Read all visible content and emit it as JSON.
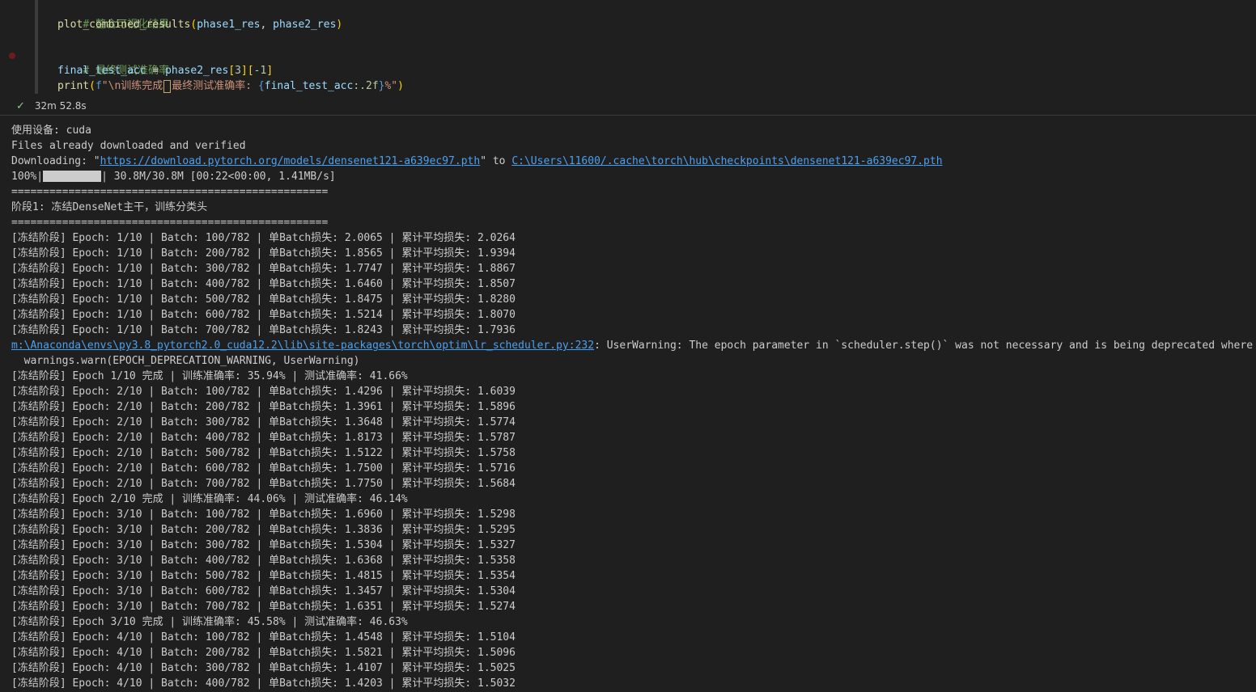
{
  "code_cell": {
    "lines": [
      {
        "comment": "# 整合可视化结果"
      },
      {
        "fn": "plot_combined_results",
        "arg1": "phase1_res",
        "arg2": "phase2_res"
      },
      {},
      {
        "comment": "# 最终测试准确率"
      },
      {
        "var": "final_test_acc",
        "rhs": "phase2_res",
        "idx1": "3",
        "idx2": "-1"
      },
      {
        "fn": "print",
        "fprefix": "f",
        "str_a": "\"\\n训练完成",
        "str_b": "最终测试准确率: ",
        "expr": "final_test_acc",
        "fmt": ":.2f",
        "str_c": "%\""
      }
    ]
  },
  "status": {
    "duration": "32m 52.8s",
    "icon": "check-icon"
  },
  "output": {
    "lines": [
      "使用设备: cuda",
      "Files already downloaded and verified",
      {
        "prefix": "Downloading: \"",
        "link1": "https://download.pytorch.org/models/densenet121-a639ec97.pth",
        "middle": "\" to ",
        "link2": "C:\\Users\\11600/.cache\\torch\\hub\\checkpoints\\densenet121-a639ec97.pth"
      },
      {
        "progress_prefix": "100%|",
        "progress_value": 1.0,
        "progress_suffix": "| 30.8M/30.8M [00:22<00:00, 1.41MB/s]"
      },
      "==================================================",
      "阶段1: 冻结DenseNet主干，训练分类头",
      "==================================================",
      "[冻结阶段] Epoch: 1/10 | Batch: 100/782 | 单Batch损失: 2.0065 | 累计平均损失: 2.0264",
      "[冻结阶段] Epoch: 1/10 | Batch: 200/782 | 单Batch损失: 1.8565 | 累计平均损失: 1.9394",
      "[冻结阶段] Epoch: 1/10 | Batch: 300/782 | 单Batch损失: 1.7747 | 累计平均损失: 1.8867",
      "[冻结阶段] Epoch: 1/10 | Batch: 400/782 | 单Batch损失: 1.6460 | 累计平均损失: 1.8507",
      "[冻结阶段] Epoch: 1/10 | Batch: 500/782 | 单Batch损失: 1.8475 | 累计平均损失: 1.8280",
      "[冻结阶段] Epoch: 1/10 | Batch: 600/782 | 单Batch损失: 1.5214 | 累计平均损失: 1.8070",
      "[冻结阶段] Epoch: 1/10 | Batch: 700/782 | 单Batch损失: 1.8243 | 累计平均损失: 1.7936",
      {
        "warn_link": "m:\\Anaconda\\envs\\py3.8_pytorch2.0_cuda12.2\\lib\\site-packages\\torch\\optim\\lr_scheduler.py:232",
        "warn_text": ": UserWarning: The epoch parameter in `scheduler.step()` was not necessary and is being deprecated where pos"
      },
      "  warnings.warn(EPOCH_DEPRECATION_WARNING, UserWarning)",
      "[冻结阶段] Epoch 1/10 完成 | 训练准确率: 35.94% | 测试准确率: 41.66%",
      "[冻结阶段] Epoch: 2/10 | Batch: 100/782 | 单Batch损失: 1.4296 | 累计平均损失: 1.6039",
      "[冻结阶段] Epoch: 2/10 | Batch: 200/782 | 单Batch损失: 1.3961 | 累计平均损失: 1.5896",
      "[冻结阶段] Epoch: 2/10 | Batch: 300/782 | 单Batch损失: 1.3648 | 累计平均损失: 1.5774",
      "[冻结阶段] Epoch: 2/10 | Batch: 400/782 | 单Batch损失: 1.8173 | 累计平均损失: 1.5787",
      "[冻结阶段] Epoch: 2/10 | Batch: 500/782 | 单Batch损失: 1.5122 | 累计平均损失: 1.5758",
      "[冻结阶段] Epoch: 2/10 | Batch: 600/782 | 单Batch损失: 1.7500 | 累计平均损失: 1.5716",
      "[冻结阶段] Epoch: 2/10 | Batch: 700/782 | 单Batch损失: 1.7750 | 累计平均损失: 1.5684",
      "[冻结阶段] Epoch 2/10 完成 | 训练准确率: 44.06% | 测试准确率: 46.14%",
      "[冻结阶段] Epoch: 3/10 | Batch: 100/782 | 单Batch损失: 1.6960 | 累计平均损失: 1.5298",
      "[冻结阶段] Epoch: 3/10 | Batch: 200/782 | 单Batch损失: 1.3836 | 累计平均损失: 1.5295",
      "[冻结阶段] Epoch: 3/10 | Batch: 300/782 | 单Batch损失: 1.5304 | 累计平均损失: 1.5327",
      "[冻结阶段] Epoch: 3/10 | Batch: 400/782 | 单Batch损失: 1.6368 | 累计平均损失: 1.5358",
      "[冻结阶段] Epoch: 3/10 | Batch: 500/782 | 单Batch损失: 1.4815 | 累计平均损失: 1.5354",
      "[冻结阶段] Epoch: 3/10 | Batch: 600/782 | 单Batch损失: 1.3457 | 累计平均损失: 1.5304",
      "[冻结阶段] Epoch: 3/10 | Batch: 700/782 | 单Batch损失: 1.6351 | 累计平均损失: 1.5274",
      "[冻结阶段] Epoch 3/10 完成 | 训练准确率: 45.58% | 测试准确率: 46.63%",
      "[冻结阶段] Epoch: 4/10 | Batch: 100/782 | 单Batch损失: 1.4548 | 累计平均损失: 1.5104",
      "[冻结阶段] Epoch: 4/10 | Batch: 200/782 | 单Batch损失: 1.5821 | 累计平均损失: 1.5096",
      "[冻结阶段] Epoch: 4/10 | Batch: 300/782 | 单Batch损失: 1.4107 | 累计平均损失: 1.5025",
      "[冻结阶段] Epoch: 4/10 | Batch: 400/782 | 单Batch损失: 1.4203 | 累计平均损失: 1.5032"
    ]
  }
}
